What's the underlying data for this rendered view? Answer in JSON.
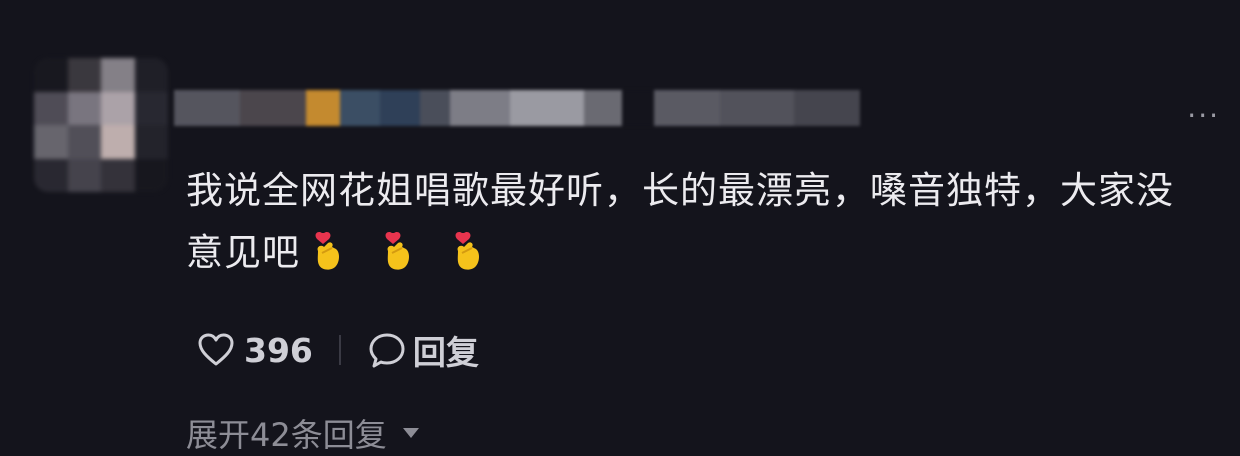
{
  "comment": {
    "text": "我说全网花姐唱歌最好听，长的最漂亮，嗓音独特，大家没意见吧",
    "emoji_icons": [
      "finger-heart-icon",
      "finger-heart-icon",
      "finger-heart-icon"
    ],
    "more_icon": "more-dots-icon",
    "more_glyph": "···",
    "likes": "396",
    "reply_label": "回复",
    "expand_label": "展开42条回复"
  },
  "colors": {
    "background": "#14141c",
    "text": "#ecebef",
    "muted": "#8d8d96"
  }
}
